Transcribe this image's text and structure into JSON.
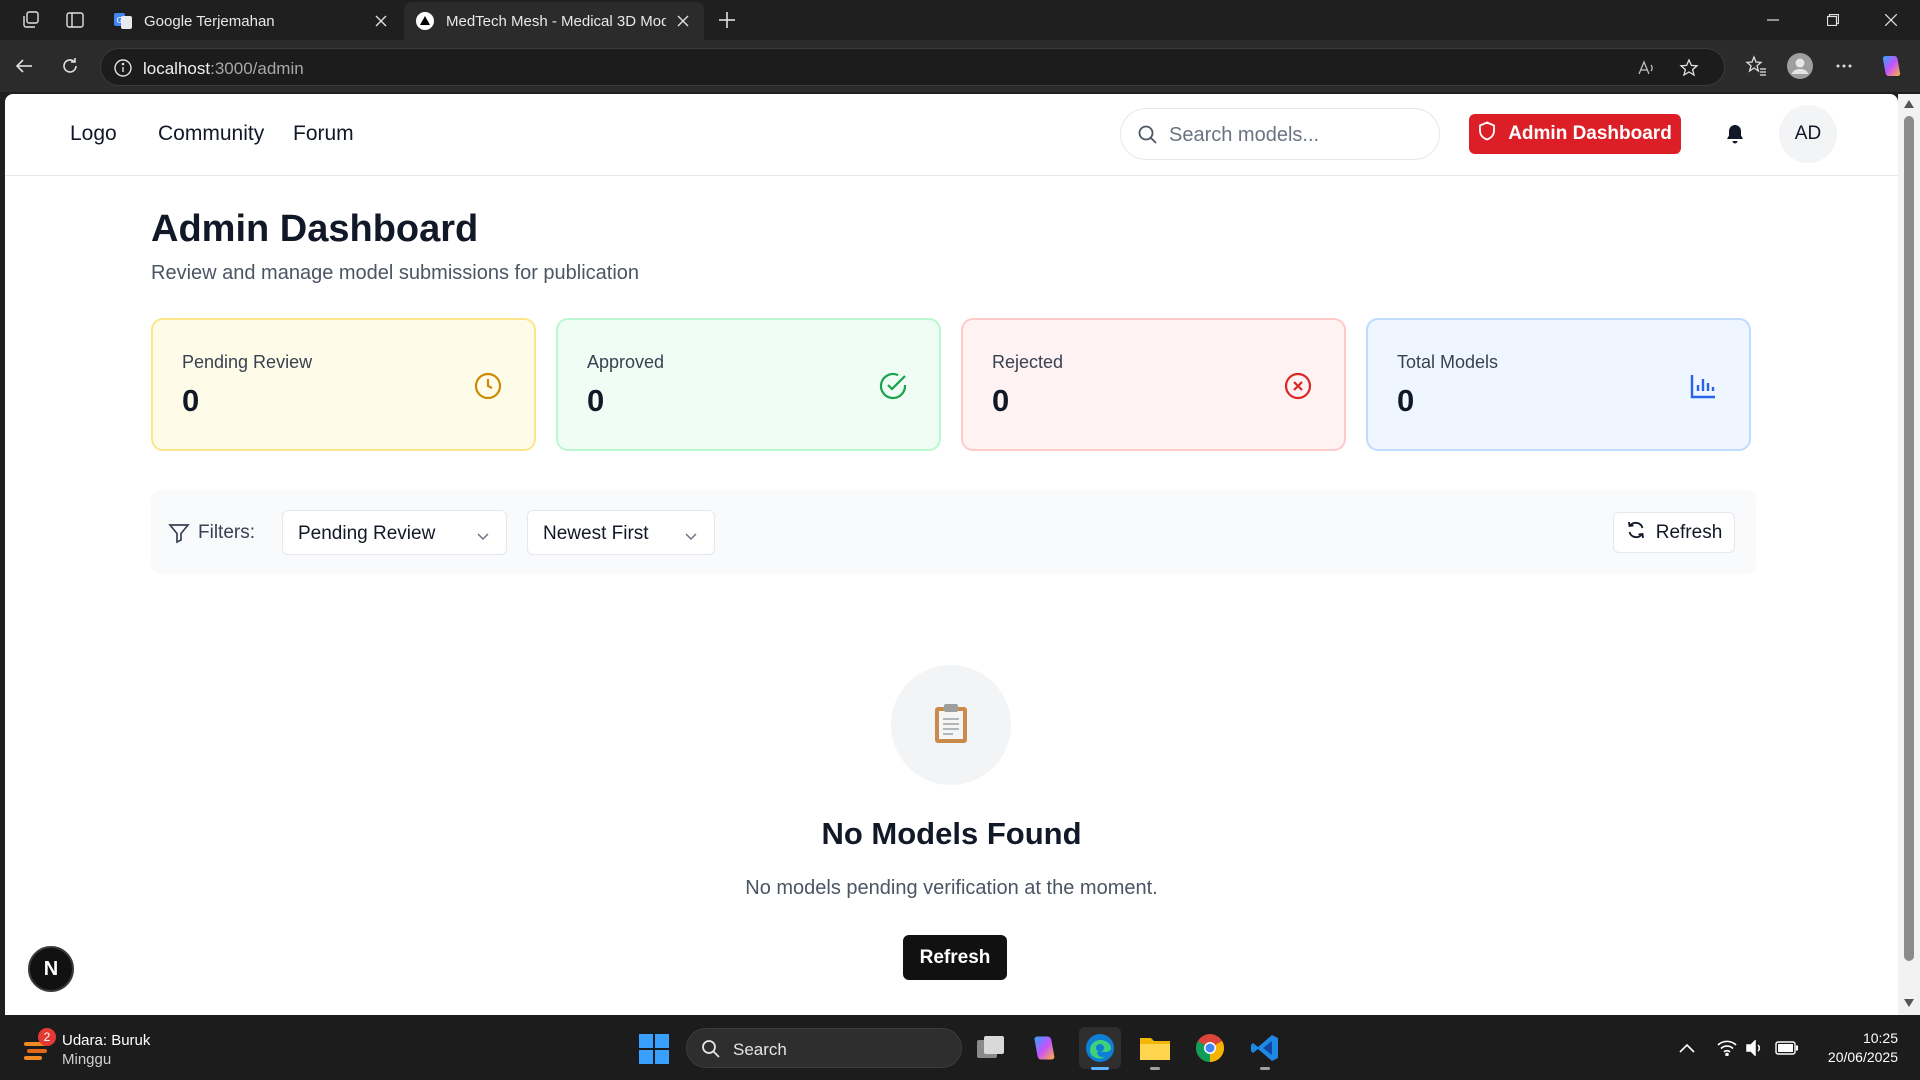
{
  "browser": {
    "tabs": [
      {
        "title": "Google Terjemahan",
        "active": false
      },
      {
        "title": "MedTech Mesh - Medical 3D Mod",
        "active": true
      }
    ],
    "url_host": "localhost",
    "url_path": ":3000/admin"
  },
  "header": {
    "nav": {
      "logo": "Logo",
      "community": "Community",
      "forum": "Forum"
    },
    "search_placeholder": "Search models...",
    "admin_button": "Admin Dashboard",
    "avatar_initials": "AD"
  },
  "page": {
    "title": "Admin Dashboard",
    "subtitle": "Review and manage model submissions for publication"
  },
  "stats": [
    {
      "label": "Pending Review",
      "value": "0",
      "icon": "clock-icon",
      "color": "#ca8a04"
    },
    {
      "label": "Approved",
      "value": "0",
      "icon": "check-circle-icon",
      "color": "#16a34a"
    },
    {
      "label": "Rejected",
      "value": "0",
      "icon": "x-circle-icon",
      "color": "#dc2626"
    },
    {
      "label": "Total Models",
      "value": "0",
      "icon": "bar-chart-icon",
      "color": "#2563eb"
    }
  ],
  "filters": {
    "label": "Filters:",
    "status_selected": "Pending Review",
    "sort_selected": "Newest First",
    "refresh_label": "Refresh"
  },
  "empty_state": {
    "title": "No Models Found",
    "message": "No models pending verification at the moment.",
    "button": "Refresh",
    "icon": "clipboard-icon"
  },
  "next_badge": "N",
  "taskbar": {
    "weather_title": "Udara: Buruk",
    "weather_sub": "Minggu",
    "weather_badge": "2",
    "search_text": "Search",
    "time": "10:25",
    "date": "20/06/2025"
  },
  "colors": {
    "admin_red": "#dc1f26",
    "pending_bg": "#fefce8",
    "approved_bg": "#f0fdf4",
    "rejected_bg": "#fef2f2",
    "total_bg": "#eff6ff"
  }
}
